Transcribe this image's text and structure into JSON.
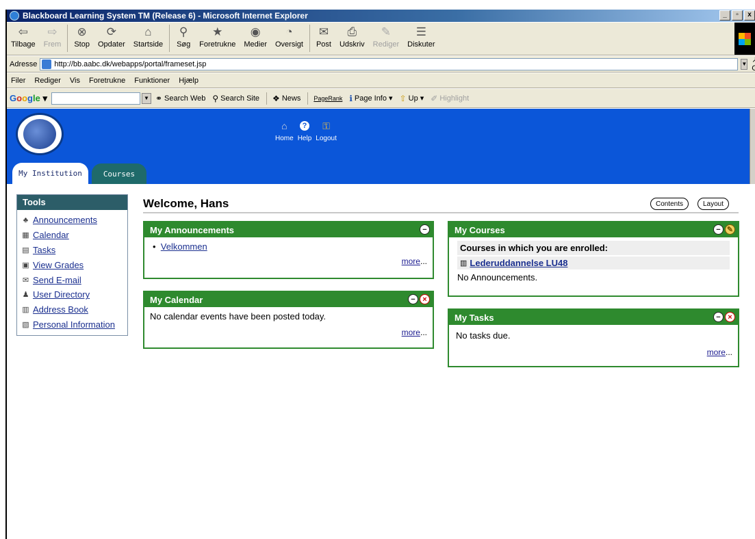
{
  "window": {
    "title": "Blackboard Learning System TM (Release 6) - Microsoft Internet Explorer",
    "controls": [
      "_",
      "▫",
      "x"
    ]
  },
  "toolbar": {
    "buttons": [
      {
        "label": "Tilbage",
        "icon": "back-arrow-icon",
        "glyph": "⇦",
        "disabled": false
      },
      {
        "label": "Frem",
        "icon": "forward-arrow-icon",
        "glyph": "⇨",
        "disabled": true
      },
      {
        "label": "Stop",
        "icon": "stop-icon",
        "glyph": "⊗",
        "disabled": false
      },
      {
        "label": "Opdater",
        "icon": "refresh-icon",
        "glyph": "⟳",
        "disabled": false
      },
      {
        "label": "Startside",
        "icon": "home-icon",
        "glyph": "⌂",
        "disabled": false
      },
      {
        "label": "Søg",
        "icon": "search-icon",
        "glyph": "⚲",
        "disabled": false
      },
      {
        "label": "Foretrukne",
        "icon": "favorites-icon",
        "glyph": "★",
        "disabled": false
      },
      {
        "label": "Medier",
        "icon": "media-icon",
        "glyph": "◉",
        "disabled": false
      },
      {
        "label": "Oversigt",
        "icon": "history-icon",
        "glyph": "◔",
        "disabled": false
      },
      {
        "label": "Post",
        "icon": "mail-icon",
        "glyph": "✉",
        "disabled": false
      },
      {
        "label": "Udskriv",
        "icon": "print-icon",
        "glyph": "⎙",
        "disabled": false
      },
      {
        "label": "Rediger",
        "icon": "edit-icon",
        "glyph": "✎",
        "disabled": true
      },
      {
        "label": "Diskuter",
        "icon": "discuss-icon",
        "glyph": "☰",
        "disabled": false
      }
    ]
  },
  "address": {
    "label": "Adresse",
    "url": "http://bb.aabc.dk/webapps/portal/frameset.jsp",
    "go_label": "Gå"
  },
  "menu": {
    "items": [
      "Filer",
      "Rediger",
      "Vis",
      "Foretrukne",
      "Funktioner",
      "Hjælp"
    ]
  },
  "googlebar": {
    "logo": [
      "G",
      "o",
      "o",
      "g",
      "le"
    ],
    "items": [
      {
        "label": "Search Web",
        "icon": "binoculars-icon",
        "glyph": "⚭",
        "disabled": false
      },
      {
        "label": "Search Site",
        "icon": "search-site-icon",
        "glyph": "⚲",
        "disabled": false
      },
      {
        "label": "News",
        "icon": "news-icon",
        "glyph": "❖",
        "disabled": false
      },
      {
        "label": "Page Info ▾",
        "icon": "info-icon",
        "glyph": "ℹ",
        "disabled": false
      },
      {
        "label": "Up ▾",
        "icon": "folder-up-icon",
        "glyph": "⇧",
        "disabled": false
      },
      {
        "label": "Highlight",
        "icon": "highlight-icon",
        "glyph": "✐",
        "disabled": true
      }
    ],
    "pagerank_label": "PageRank"
  },
  "bb": {
    "top_links": [
      {
        "label": "Home",
        "icon": "home-building-icon",
        "glyph": "⌂"
      },
      {
        "label": "Help",
        "icon": "help-icon",
        "glyph": "?"
      },
      {
        "label": "Logout",
        "icon": "lock-icon",
        "glyph": "⚿"
      }
    ],
    "tabs": [
      "My Institution",
      "Courses"
    ]
  },
  "tools": {
    "title": "Tools",
    "items": [
      {
        "label": "Announcements",
        "icon": "announcement-pin-icon",
        "glyph": "♣"
      },
      {
        "label": "Calendar",
        "icon": "calendar-icon",
        "glyph": "▦"
      },
      {
        "label": "Tasks",
        "icon": "tasks-icon",
        "glyph": "▤"
      },
      {
        "label": "View Grades",
        "icon": "grades-icon",
        "glyph": "▣"
      },
      {
        "label": "Send E-mail",
        "icon": "email-icon",
        "glyph": "✉"
      },
      {
        "label": "User Directory",
        "icon": "users-icon",
        "glyph": "♟"
      },
      {
        "label": "Address Book",
        "icon": "address-book-icon",
        "glyph": "▥"
      },
      {
        "label": "Personal Information",
        "icon": "personal-info-icon",
        "glyph": "▧"
      }
    ]
  },
  "main": {
    "welcome": "Welcome, Hans",
    "contents_btn": "Contents",
    "layout_btn": "Layout",
    "more": "more",
    "ellipsis": "...",
    "announcements": {
      "title": "My Announcements",
      "items": [
        "Velkommen"
      ]
    },
    "calendar": {
      "title": "My Calendar",
      "text": "No calendar events have been posted today."
    },
    "courses": {
      "title": "My Courses",
      "enrolled": "Courses in which you are enrolled:",
      "course": "Lederuddannelse LU48",
      "no_ann": "No Announcements."
    },
    "tasks": {
      "title": "My Tasks",
      "text": "No tasks due."
    }
  }
}
